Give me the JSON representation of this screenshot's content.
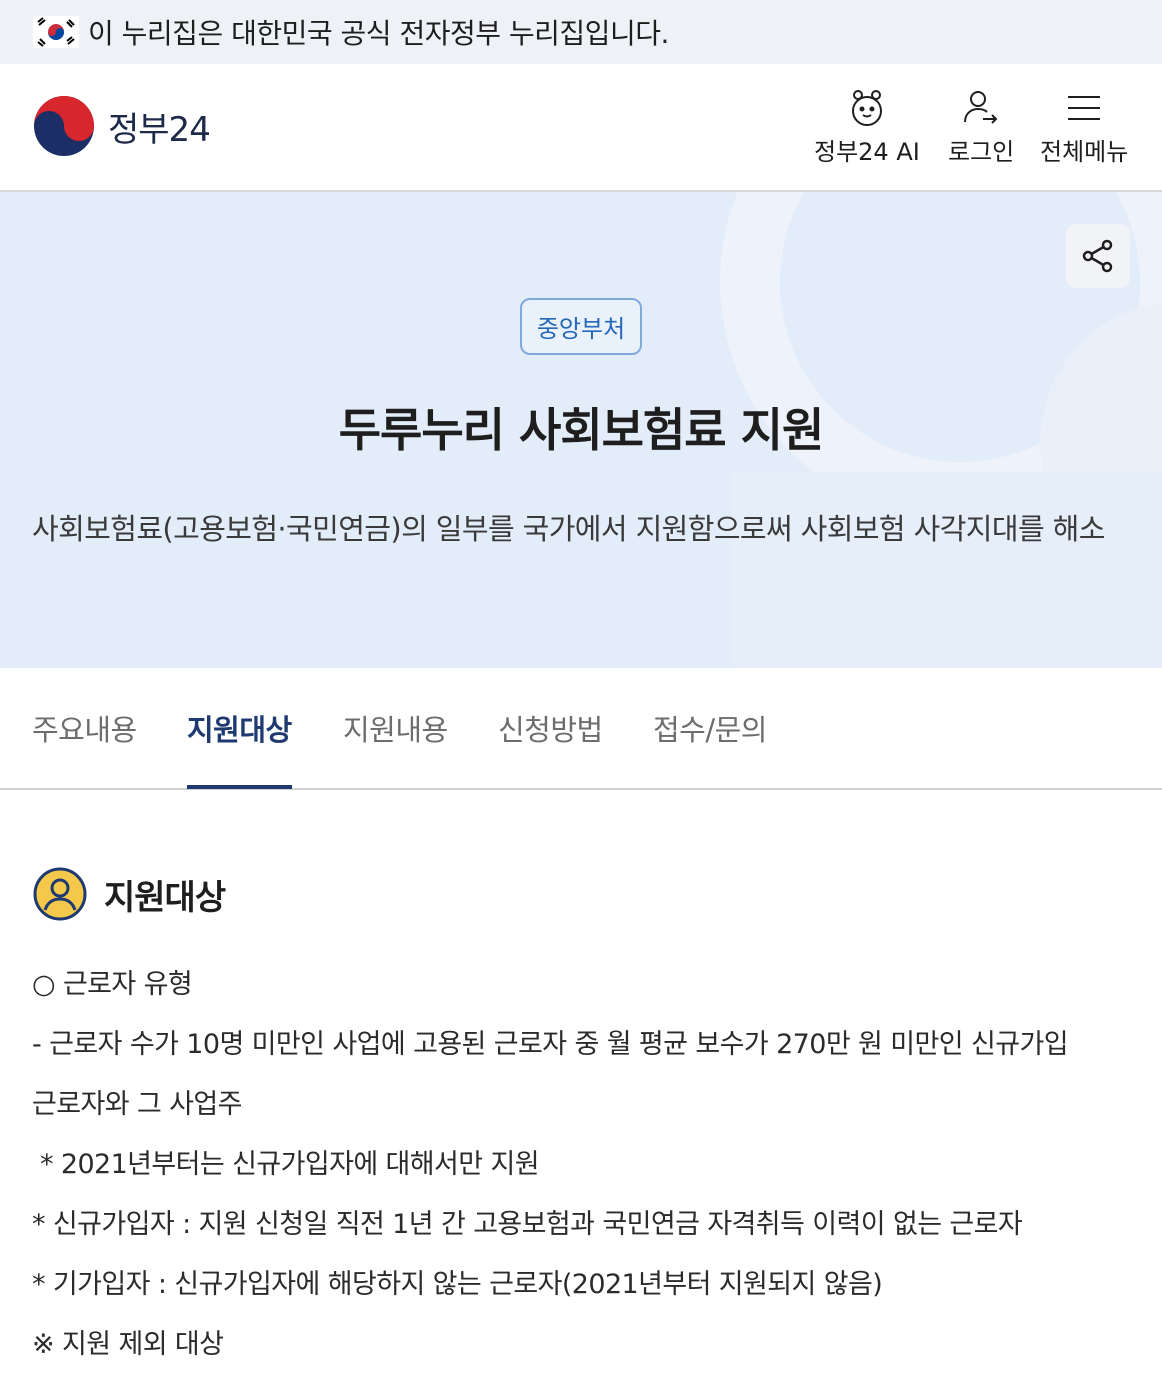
{
  "banner": {
    "text": "이 누리집은 대한민국 공식 전자정부 누리집입니다."
  },
  "header": {
    "logo_text": "정부24",
    "ai_label": "정부24 AI",
    "login_label": "로그인",
    "menu_label": "전체메뉴"
  },
  "hero": {
    "badge": "중앙부처",
    "title": "두루누리 사회보험료 지원",
    "description": "사회보험료(고용보험·국민연금)의 일부를 국가에서 지원함으로써 사회보험 사각지대를 해소"
  },
  "tabs": [
    {
      "label": "주요내용"
    },
    {
      "label": "지원대상"
    },
    {
      "label": "지원내용"
    },
    {
      "label": "신청방법"
    },
    {
      "label": "접수/문의"
    }
  ],
  "active_tab": "지원대상",
  "section": {
    "title": "지원대상",
    "lines": [
      "○ 근로자 유형",
      "- 근로자 수가 10명 미만인 사업에 고용된 근로자 중 월 평균 보수가 270만 원 미만인 신규가입",
      "근로자와 그 사업주",
      " * 2021년부터는 신규가입자에 대해서만 지원",
      "* 신규가입자 : 지원 신청일 직전 1년 간 고용보험과 국민연금 자격취득 이력이 없는 근로자",
      "* 기가입자 : 신규가입자에 해당하지 않는 근로자(2021년부터 지원되지 않음)",
      "※ 지원 제외 대상"
    ]
  },
  "colors": {
    "accent": "#1f3a70",
    "hero_bg": "#e3ecf9",
    "badge": "#2568b8"
  }
}
